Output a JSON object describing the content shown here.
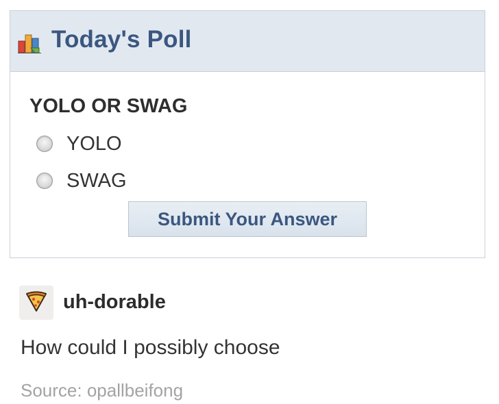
{
  "poll": {
    "title": "Today's Poll",
    "icon": "bar-chart-icon",
    "question": "YOLO OR SWAG",
    "options": [
      {
        "label": "YOLO",
        "selected": false
      },
      {
        "label": "SWAG",
        "selected": false
      }
    ],
    "submit_label": "Submit Your Answer"
  },
  "post": {
    "username": "uh-dorable",
    "avatar_icon": "pizza-slice-icon",
    "text": "How could I possibly choose",
    "source_prefix": "Source: ",
    "source_name": "opallbeifong"
  },
  "colors": {
    "header_bg": "#e1e8f0",
    "title_blue": "#3b5780",
    "border": "#c7cfd8",
    "source_gray": "#a3a3a3"
  }
}
